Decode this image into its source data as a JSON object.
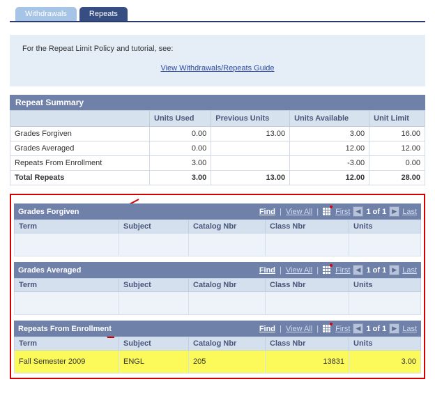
{
  "tabs": {
    "withdrawals": "Withdrawals",
    "repeats": "Repeats"
  },
  "intro": {
    "text": "For the Repeat Limit Policy and tutorial, see:",
    "link_label": "View Withdrawals/Repeats Guide"
  },
  "summary": {
    "title": "Repeat Summary",
    "headers": {
      "blank": "",
      "units_used": "Units Used",
      "previous_units": "Previous Units",
      "units_available": "Units Available",
      "unit_limit": "Unit Limit"
    },
    "rows": [
      {
        "label": "Grades Forgiven",
        "used": "0.00",
        "prev": "13.00",
        "avail": "3.00",
        "limit": "16.00"
      },
      {
        "label": "Grades Averaged",
        "used": "0.00",
        "prev": "",
        "avail": "12.00",
        "limit": "12.00"
      },
      {
        "label": "Repeats From Enrollment",
        "used": "3.00",
        "prev": "",
        "avail": "-3.00",
        "limit": "0.00"
      }
    ],
    "total": {
      "label": "Total Repeats",
      "used": "3.00",
      "prev": "13.00",
      "avail": "12.00",
      "limit": "28.00"
    }
  },
  "grid_headers": {
    "term": "Term",
    "subject": "Subject",
    "catalog": "Catalog Nbr",
    "class": "Class Nbr",
    "units": "Units"
  },
  "toolbar": {
    "find": "Find",
    "view_all": "View All",
    "first": "First",
    "last": "Last",
    "count": "1 of 1"
  },
  "panels": {
    "forgiven": {
      "title": "Grades Forgiven"
    },
    "averaged": {
      "title": "Grades Averaged"
    },
    "enrollment": {
      "title": "Repeats From Enrollment",
      "row": {
        "term": "Fall Semester 2009",
        "subject": "ENGL",
        "catalog": "205",
        "class": "13831",
        "units": "3.00"
      }
    }
  }
}
